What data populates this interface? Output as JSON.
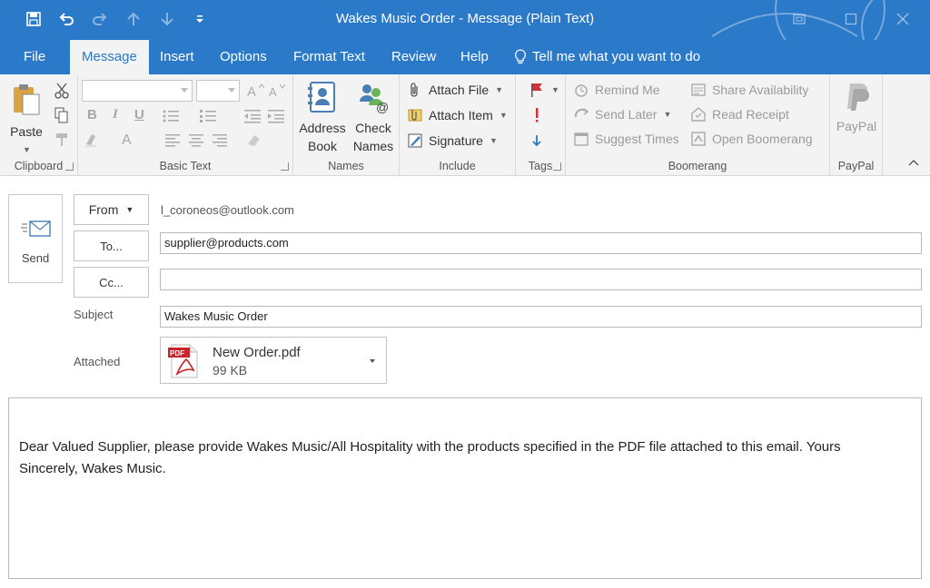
{
  "window": {
    "title": "Wakes Music Order  -  Message (Plain Text)",
    "accent": "#2b79c9"
  },
  "qat_icons": [
    "save-icon",
    "undo-icon",
    "redo-icon",
    "up-arrow-icon",
    "down-arrow-icon",
    "customize-qat-icon"
  ],
  "window_controls": [
    "restore-ribbon-icon",
    "maximize-icon",
    "close-icon"
  ],
  "tabs": [
    "File",
    "Message",
    "Insert",
    "Options",
    "Format Text",
    "Review",
    "Help"
  ],
  "active_tab": "Message",
  "tell_me": "Tell me what you want to do",
  "ribbon": {
    "clipboard": {
      "label": "Clipboard",
      "paste": "Paste"
    },
    "basic_text": {
      "label": "Basic Text",
      "font": "",
      "size": ""
    },
    "names": {
      "label": "Names",
      "address_book_1": "Address",
      "address_book_2": "Book",
      "check_names_1": "Check",
      "check_names_2": "Names"
    },
    "include": {
      "label": "Include",
      "attach_file": "Attach File",
      "attach_item": "Attach Item",
      "signature": "Signature"
    },
    "tags": {
      "label": "Tags"
    },
    "boomerang": {
      "label": "Boomerang",
      "remind_me": "Remind Me",
      "send_later": "Send Later",
      "suggest_times": "Suggest Times",
      "share_availability": "Share Availability",
      "read_receipt": "Read Receipt",
      "open_boomerang": "Open Boomerang"
    },
    "paypal": {
      "label": "PayPal",
      "button": "PayPal"
    }
  },
  "compose": {
    "send": "Send",
    "from_button": "From",
    "from_value": "l_coroneos@outlook.com",
    "to_button": "To...",
    "to_value": "supplier@products.com",
    "cc_button": "Cc...",
    "cc_value": "",
    "subject_label": "Subject",
    "subject_value": "Wakes Music Order",
    "attached_label": "Attached",
    "attachment": {
      "name": "New Order.pdf",
      "size": "99 KB",
      "badge": "PDF"
    },
    "body": "Dear Valued Supplier, please provide Wakes Music/All Hospitality with the products specified in the PDF file attached to this email. Yours Sincerely, Wakes Music."
  }
}
